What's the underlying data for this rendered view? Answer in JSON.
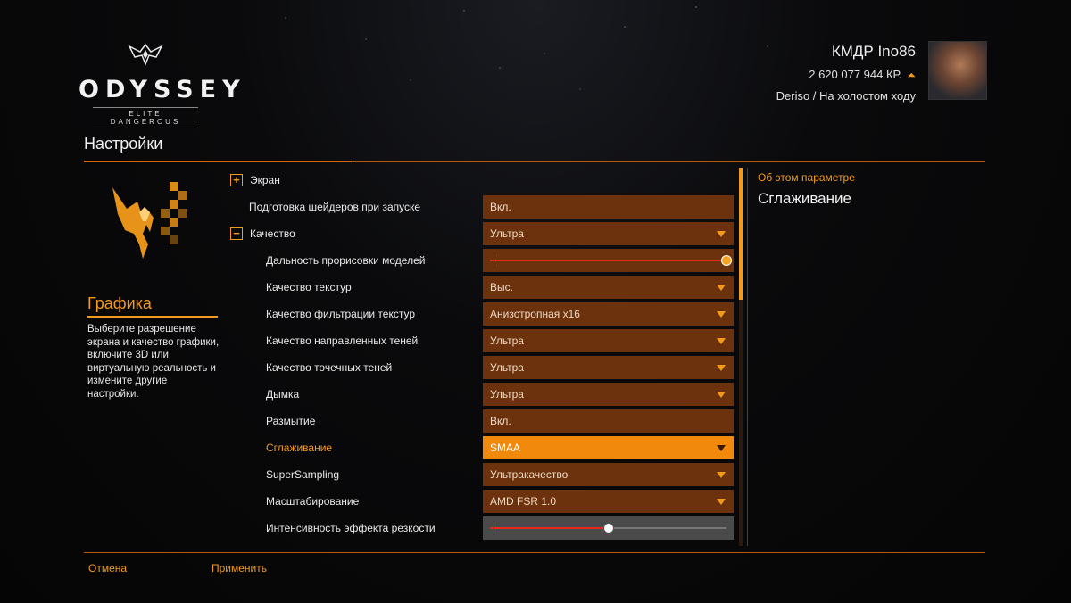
{
  "logo": {
    "title": "ODYSSEY",
    "subtitle": "ELITE DANGEROUS"
  },
  "commander": {
    "name": "КМДР Ino86",
    "credits": "2 620 077 944 КР.",
    "status": "Deriso / На холостом ходу"
  },
  "page_title": "Настройки",
  "category": {
    "title": "Графика",
    "description": "Выберите разрешение экрана и качество графики, включите 3D или виртуальную реальность и измените другие настройки."
  },
  "settings": [
    {
      "label": "Экран",
      "level": 0,
      "toggle": "+",
      "type": "none"
    },
    {
      "label": "Подготовка шейдеров при запуске",
      "level": 0,
      "toggle": "",
      "type": "value",
      "value": "Вкл."
    },
    {
      "label": "Качество",
      "level": 0,
      "toggle": "−",
      "type": "dropdown",
      "value": "Ультра"
    },
    {
      "label": "Дальность прорисовки моделей",
      "level": 1,
      "type": "slider",
      "level_value": 1.0
    },
    {
      "label": "Качество текстур",
      "level": 1,
      "type": "dropdown",
      "value": "Выс."
    },
    {
      "label": "Качество фильтрации текстур",
      "level": 1,
      "type": "dropdown",
      "value": "Анизотропная x16"
    },
    {
      "label": "Качество направленных теней",
      "level": 1,
      "type": "dropdown",
      "value": "Ультра"
    },
    {
      "label": "Качество точечных теней",
      "level": 1,
      "type": "dropdown",
      "value": "Ультра"
    },
    {
      "label": "Дымка",
      "level": 1,
      "type": "dropdown",
      "value": "Ультра"
    },
    {
      "label": "Размытие",
      "level": 1,
      "type": "value",
      "value": "Вкл."
    },
    {
      "label": "Сглаживание",
      "level": 1,
      "type": "dropdown",
      "value": "SMAA",
      "active": true
    },
    {
      "label": "SuperSampling",
      "level": 1,
      "type": "dropdown",
      "value": "Ультракачество"
    },
    {
      "label": "Масштабирование",
      "level": 1,
      "type": "dropdown",
      "value": "AMD FSR 1.0"
    },
    {
      "label": "Интенсивность эффекта резкости",
      "level": 1,
      "type": "slider",
      "level_value": 0.5,
      "grey": true
    }
  ],
  "info_panel": {
    "title": "Об этом параметре",
    "param": "Сглаживание"
  },
  "buttons": {
    "cancel": "Отмена",
    "apply": "Применить"
  },
  "colors": {
    "accent": "#f39a1a",
    "control_bg": "#6b320d",
    "highlight": "#f0890c",
    "slider_fill": "#e8281c"
  }
}
